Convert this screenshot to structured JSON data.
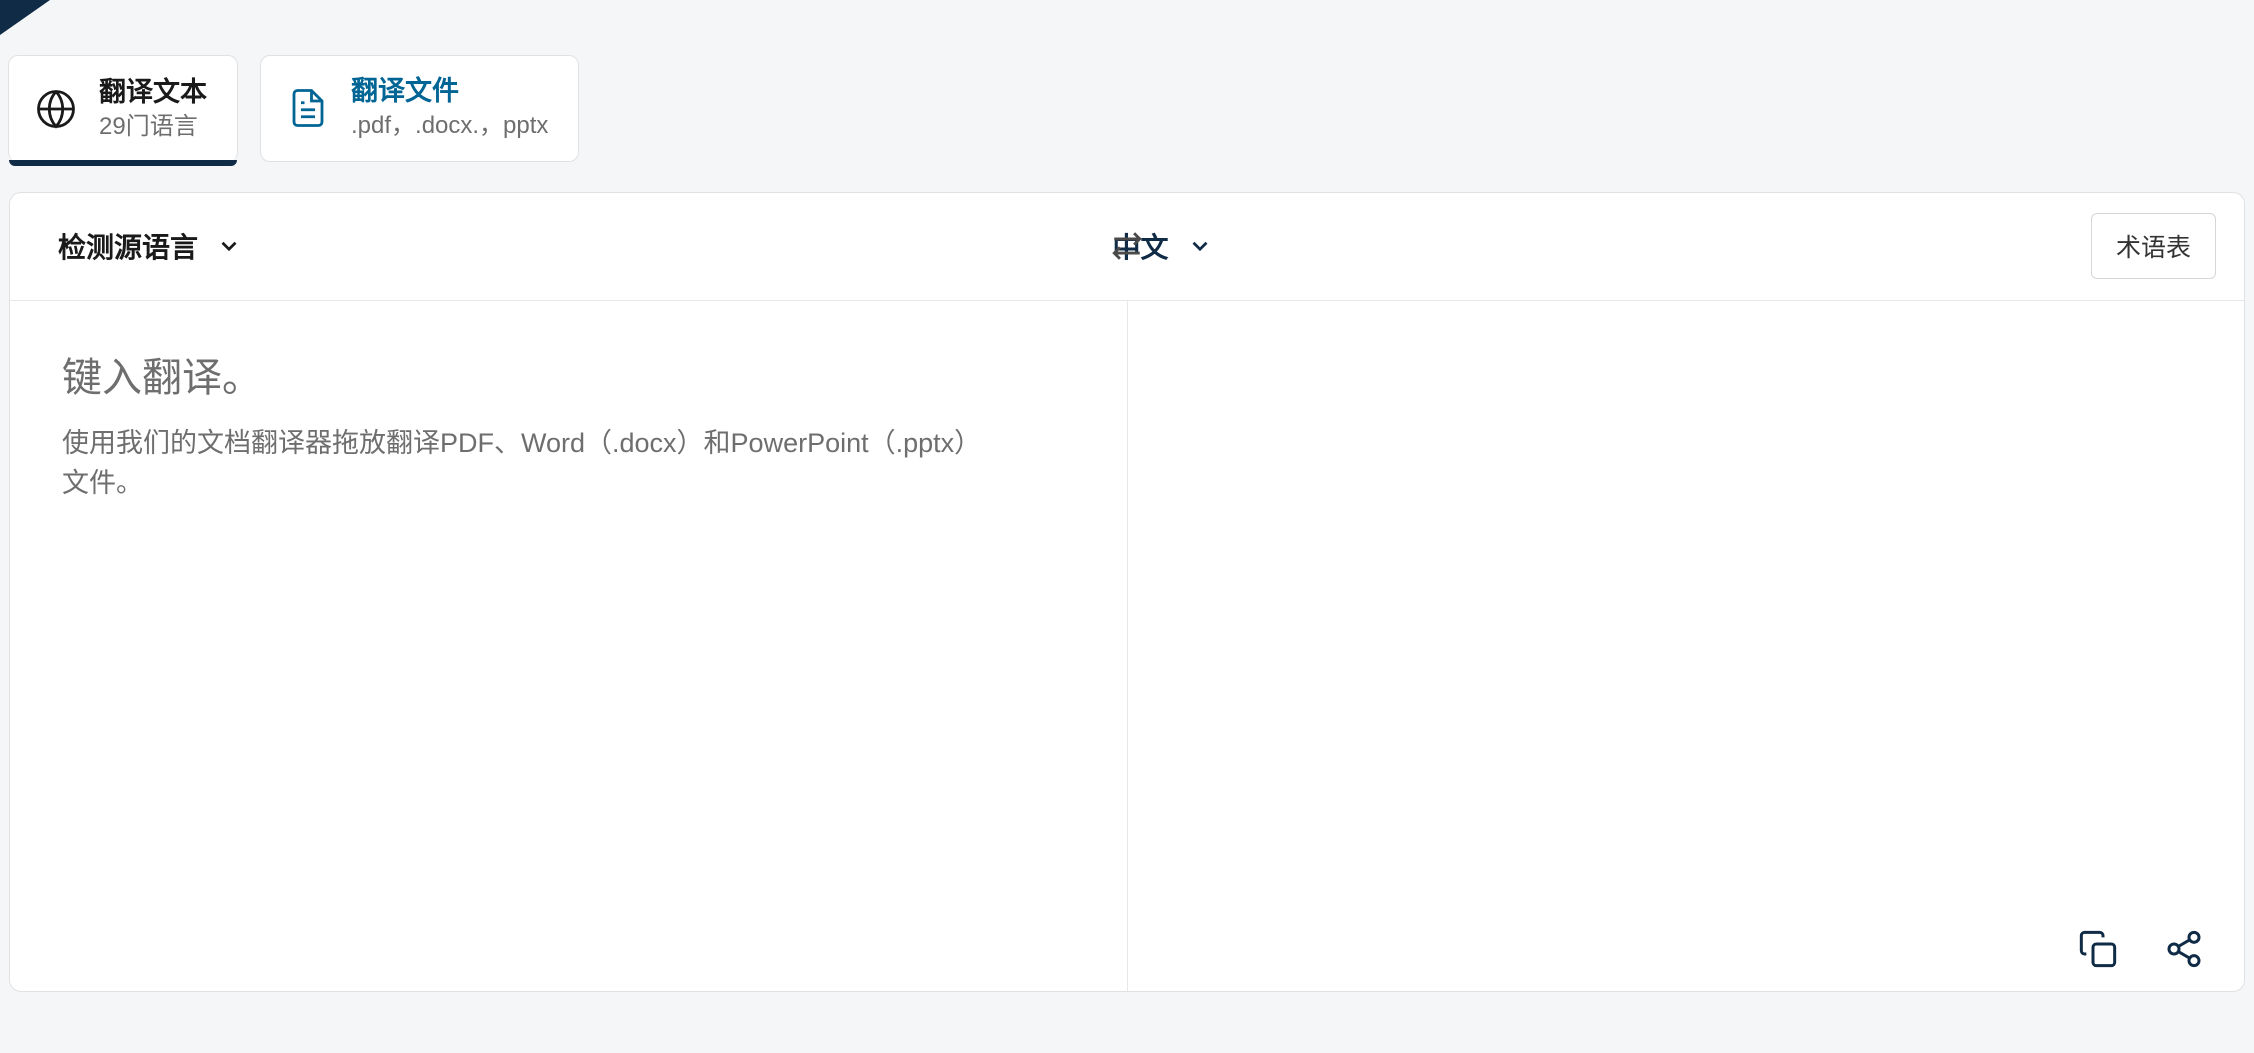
{
  "tabs": {
    "text_tab": {
      "title": "翻译文本",
      "subtitle": "29门语言"
    },
    "file_tab": {
      "title": "翻译文件",
      "subtitle": ".pdf，.docx.，pptx"
    }
  },
  "lang_bar": {
    "source_label": "检测源语言",
    "target_label": "中文",
    "glossary_btn": "术语表"
  },
  "input": {
    "placeholder_title": "键入翻译。",
    "placeholder_desc": "使用我们的文档翻译器拖放翻译PDF、Word（.docx）和PowerPoint（.pptx）文件。"
  }
}
